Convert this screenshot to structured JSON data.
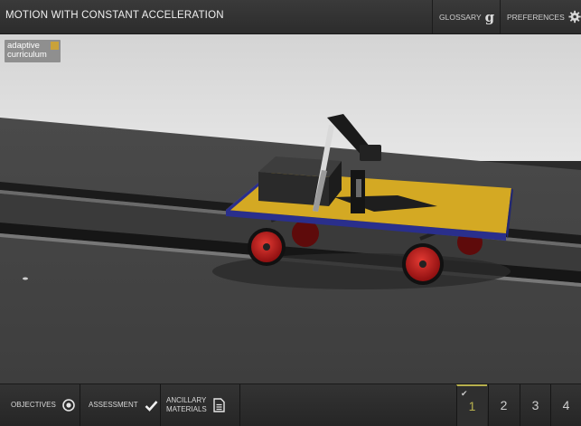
{
  "header": {
    "title": "MOTION WITH CONSTANT ACCELERATION",
    "glossary_label": "GLOSSARY",
    "preferences_label": "PREFERENCES"
  },
  "logo": {
    "line1": "adaptive",
    "line2": "curriculum"
  },
  "footer": {
    "objectives_label": "OBJECTIVES",
    "assessment_label": "ASSESSMENT",
    "ancillary_line1": "ANCILLARY",
    "ancillary_line2": "MATERIALS"
  },
  "pages": [
    {
      "number": "1",
      "active": true,
      "completed": true
    },
    {
      "number": "2",
      "active": false,
      "completed": false
    },
    {
      "number": "3",
      "active": false,
      "completed": false
    },
    {
      "number": "4",
      "active": false,
      "completed": false
    }
  ],
  "colors": {
    "accent": "#b7b04e",
    "cart_deck": "#d4a923",
    "cart_frame": "#2a2f8c",
    "wheel": "#c8171a"
  }
}
